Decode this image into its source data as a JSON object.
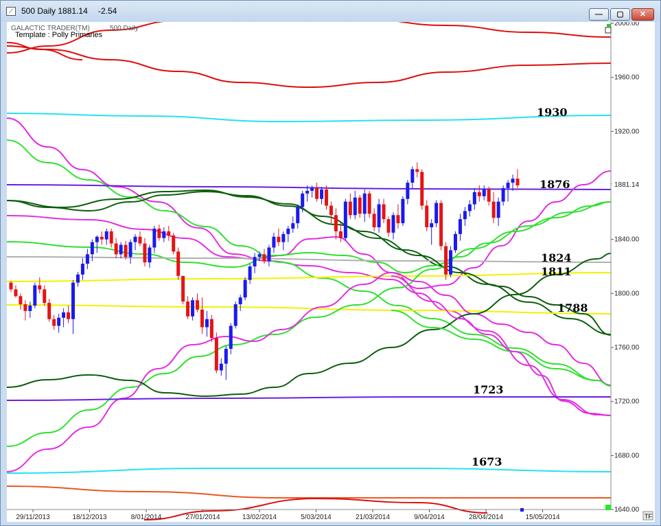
{
  "window": {
    "title": "500 Daily 1881.14",
    "change": "-2.54",
    "app_icon": "chart-icon",
    "buttons": {
      "minimize": "—",
      "maximize": "▢",
      "close": "✕"
    }
  },
  "chart_header": {
    "brand": "GALACTIC TRADER(TM)",
    "symbol": "500 Daily",
    "template": "Template : Polly Primaries"
  },
  "tf_label": "TF",
  "price_badge": "1881.14",
  "colors": {
    "up_candle": "#1a1aee",
    "down_candle": "#e51414",
    "red": "#dd0f0f",
    "cyan": "#24e2f0",
    "magenta": "#e22de2",
    "green": "#2fe02f",
    "dark_green": "#0d5e0d",
    "purple": "#6a1ee0",
    "gray": "#b0b0b0",
    "yellow": "#f2f200",
    "orange": "#ee5522"
  },
  "chart_data": {
    "type": "candlestick",
    "title": "500 Daily 1881.14",
    "ylim": [
      1640,
      2000
    ],
    "y_ticks": [
      "2000.00",
      "1960.00",
      "1920.00",
      "1881.14",
      "1840.00",
      "1800.00",
      "1760.00",
      "1720.00",
      "1680.00",
      "1640.00"
    ],
    "x_ticks": [
      "29/11/2013",
      "18/12/2013",
      "8/01/2014",
      "27/01/2014",
      "13/02/2014",
      "5/03/2014",
      "21/03/2014",
      "9/04/2014",
      "28/04/2014",
      "15/05/2014"
    ],
    "level_labels": [
      "1930",
      "1876",
      "1824",
      "1811",
      "1788",
      "1723",
      "1673"
    ],
    "candles": [
      [
        1808,
        1809,
        1801,
        1803
      ],
      [
        1803,
        1806,
        1797,
        1798
      ],
      [
        1798,
        1800,
        1788,
        1792
      ],
      [
        1792,
        1795,
        1780,
        1787
      ],
      [
        1787,
        1794,
        1782,
        1791
      ],
      [
        1791,
        1808,
        1789,
        1806
      ],
      [
        1806,
        1812,
        1800,
        1803
      ],
      [
        1803,
        1806,
        1791,
        1793
      ],
      [
        1793,
        1796,
        1779,
        1781
      ],
      [
        1781,
        1784,
        1773,
        1776
      ],
      [
        1776,
        1785,
        1771,
        1782
      ],
      [
        1782,
        1789,
        1775,
        1786
      ],
      [
        1786,
        1791,
        1778,
        1781
      ],
      [
        1781,
        1810,
        1770,
        1808
      ],
      [
        1808,
        1816,
        1805,
        1814
      ],
      [
        1814,
        1826,
        1810,
        1822
      ],
      [
        1822,
        1833,
        1818,
        1829
      ],
      [
        1829,
        1840,
        1824,
        1838
      ],
      [
        1838,
        1843,
        1830,
        1842
      ],
      [
        1842,
        1846,
        1836,
        1840
      ],
      [
        1840,
        1848,
        1836,
        1846
      ],
      [
        1846,
        1848,
        1834,
        1837
      ],
      [
        1837,
        1841,
        1826,
        1829
      ],
      [
        1829,
        1838,
        1826,
        1836
      ],
      [
        1836,
        1839,
        1825,
        1827
      ],
      [
        1827,
        1840,
        1822,
        1838
      ],
      [
        1838,
        1844,
        1832,
        1842
      ],
      [
        1842,
        1846,
        1835,
        1837
      ],
      [
        1837,
        1841,
        1820,
        1823
      ],
      [
        1823,
        1836,
        1819,
        1834
      ],
      [
        1834,
        1850,
        1830,
        1848
      ],
      [
        1848,
        1851,
        1839,
        1841
      ],
      [
        1841,
        1849,
        1838,
        1846
      ],
      [
        1846,
        1850,
        1839,
        1843
      ],
      [
        1843,
        1845,
        1829,
        1831
      ],
      [
        1831,
        1834,
        1810,
        1813
      ],
      [
        1813,
        1812,
        1792,
        1794
      ],
      [
        1794,
        1798,
        1781,
        1783
      ],
      [
        1783,
        1797,
        1780,
        1795
      ],
      [
        1795,
        1800,
        1786,
        1788
      ],
      [
        1788,
        1797,
        1770,
        1775
      ],
      [
        1775,
        1787,
        1768,
        1781
      ],
      [
        1781,
        1784,
        1764,
        1767
      ],
      [
        1767,
        1771,
        1741,
        1743
      ],
      [
        1743,
        1752,
        1739,
        1748
      ],
      [
        1748,
        1761,
        1736,
        1759
      ],
      [
        1759,
        1778,
        1755,
        1776
      ],
      [
        1776,
        1794,
        1774,
        1792
      ],
      [
        1792,
        1799,
        1787,
        1797
      ],
      [
        1797,
        1812,
        1795,
        1810
      ],
      [
        1810,
        1822,
        1807,
        1820
      ],
      [
        1820,
        1830,
        1815,
        1827
      ],
      [
        1827,
        1831,
        1824,
        1829
      ],
      [
        1829,
        1833,
        1822,
        1824
      ],
      [
        1824,
        1836,
        1820,
        1834
      ],
      [
        1834,
        1845,
        1830,
        1842
      ],
      [
        1842,
        1848,
        1835,
        1838
      ],
      [
        1838,
        1846,
        1832,
        1844
      ],
      [
        1844,
        1850,
        1838,
        1848
      ],
      [
        1848,
        1857,
        1845,
        1852
      ],
      [
        1852,
        1866,
        1848,
        1864
      ],
      [
        1864,
        1876,
        1860,
        1874
      ],
      [
        1874,
        1880,
        1868,
        1876
      ],
      [
        1876,
        1880,
        1871,
        1878
      ],
      [
        1878,
        1882,
        1868,
        1870
      ],
      [
        1870,
        1879,
        1866,
        1877
      ],
      [
        1877,
        1880,
        1862,
        1865
      ],
      [
        1865,
        1868,
        1852,
        1858
      ],
      [
        1858,
        1863,
        1840,
        1846
      ],
      [
        1846,
        1852,
        1838,
        1841
      ],
      [
        1841,
        1870,
        1839,
        1868
      ],
      [
        1868,
        1874,
        1855,
        1858
      ],
      [
        1858,
        1876,
        1855,
        1871
      ],
      [
        1871,
        1873,
        1856,
        1859
      ],
      [
        1859,
        1877,
        1853,
        1874
      ],
      [
        1874,
        1876,
        1856,
        1859
      ],
      [
        1859,
        1863,
        1846,
        1849
      ],
      [
        1849,
        1870,
        1845,
        1866
      ],
      [
        1866,
        1870,
        1852,
        1855
      ],
      [
        1855,
        1857,
        1842,
        1845
      ],
      [
        1845,
        1860,
        1840,
        1858
      ],
      [
        1858,
        1866,
        1848,
        1852
      ],
      [
        1852,
        1872,
        1850,
        1870
      ],
      [
        1870,
        1884,
        1866,
        1882
      ],
      [
        1882,
        1894,
        1878,
        1892
      ],
      [
        1892,
        1897,
        1886,
        1890
      ],
      [
        1890,
        1892,
        1862,
        1865
      ],
      [
        1865,
        1869,
        1846,
        1849
      ],
      [
        1849,
        1855,
        1836,
        1852
      ],
      [
        1852,
        1869,
        1849,
        1867
      ],
      [
        1867,
        1869,
        1832,
        1835
      ],
      [
        1835,
        1838,
        1810,
        1814
      ],
      [
        1814,
        1835,
        1812,
        1832
      ],
      [
        1832,
        1846,
        1830,
        1844
      ],
      [
        1844,
        1859,
        1839,
        1855
      ],
      [
        1855,
        1864,
        1850,
        1861
      ],
      [
        1861,
        1869,
        1857,
        1866
      ],
      [
        1866,
        1878,
        1862,
        1875
      ],
      [
        1875,
        1880,
        1868,
        1872
      ],
      [
        1872,
        1880,
        1869,
        1877
      ],
      [
        1877,
        1879,
        1865,
        1868
      ],
      [
        1868,
        1875,
        1852,
        1856
      ],
      [
        1856,
        1871,
        1850,
        1868
      ],
      [
        1868,
        1880,
        1865,
        1878
      ],
      [
        1878,
        1884,
        1868,
        1882
      ],
      [
        1882,
        1888,
        1876,
        1885
      ],
      [
        1885,
        1892,
        1878,
        1880
      ]
    ]
  }
}
